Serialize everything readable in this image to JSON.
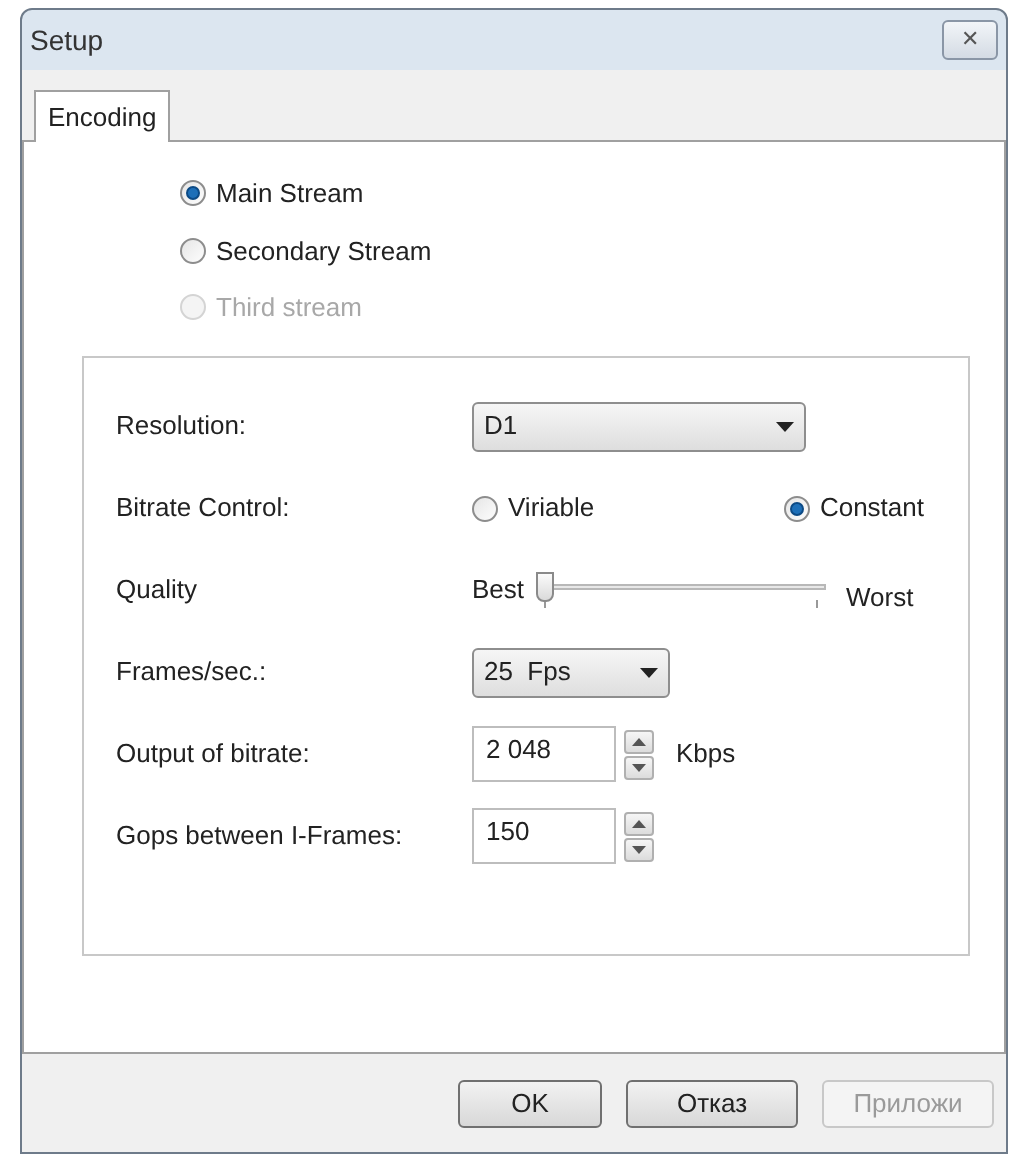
{
  "window": {
    "title": "Setup",
    "close": "✕"
  },
  "tabs": [
    {
      "label": "Encoding",
      "selected": true
    }
  ],
  "streams": [
    {
      "label": "Main Stream",
      "selected": true,
      "disabled": false
    },
    {
      "label": "Secondary Stream",
      "selected": false,
      "disabled": false
    },
    {
      "label": "Third stream",
      "selected": false,
      "disabled": true
    }
  ],
  "settings": [
    {
      "kind": "dropdown",
      "label": "Resolution:",
      "value": "D1",
      "wide": true
    },
    {
      "kind": "radio",
      "label": "Bitrate Control:",
      "options": [
        {
          "label": "Viriable",
          "selected": false
        },
        {
          "label": "Constant",
          "selected": true
        }
      ]
    },
    {
      "kind": "slider",
      "label": "Quality",
      "min_label": "Best",
      "max_label": "Worst",
      "level": 0
    },
    {
      "kind": "dropdown",
      "label": "Frames/sec.:",
      "value": "25  Fps",
      "wide": false
    },
    {
      "kind": "spinner",
      "label": "Output of bitrate:",
      "value": "2 048",
      "unit": "Kbps"
    },
    {
      "kind": "spinner",
      "label": "Gops between I-Frames:",
      "value": "150"
    }
  ],
  "buttons": [
    {
      "label": "OK",
      "disabled": false
    },
    {
      "label": "Отказ",
      "disabled": false
    },
    {
      "label": "Приложи",
      "disabled": true
    }
  ]
}
